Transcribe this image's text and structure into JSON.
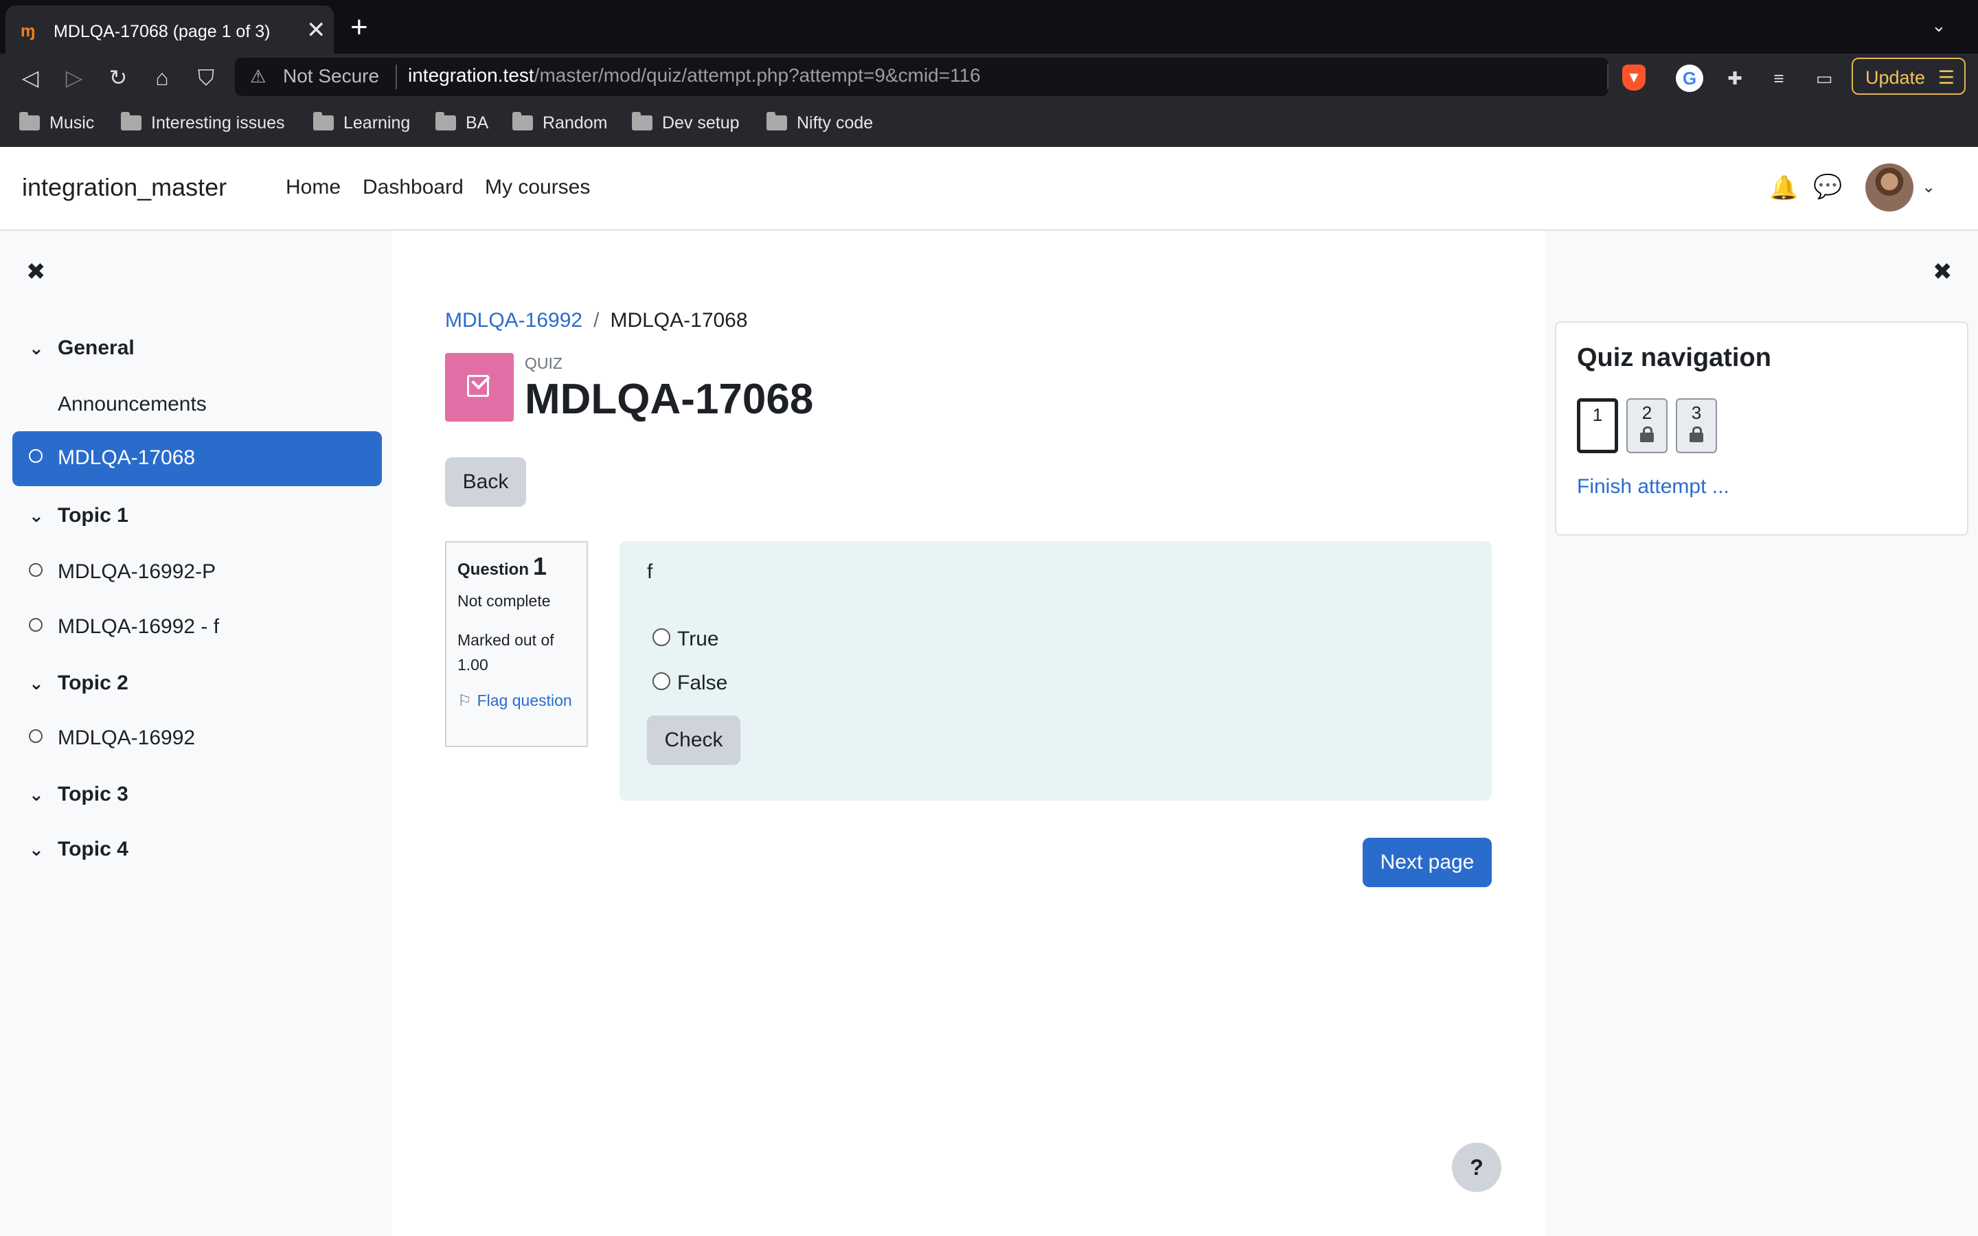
{
  "browser": {
    "tab_title": "MDLQA-17068 (page 1 of 3)",
    "tab_close": "✕",
    "new_tab": "+",
    "not_secure": "Not Secure",
    "url_host": "integration.test",
    "url_path": "/master/mod/quiz/attempt.php?attempt=9&cmid=116",
    "update_label": "Update",
    "bookmarks": [
      "Music",
      "Interesting issues",
      "Learning",
      "BA",
      "Random",
      "Dev setup",
      "Nifty code"
    ]
  },
  "header": {
    "site_name": "integration_master",
    "nav": [
      "Home",
      "Dashboard",
      "My courses"
    ]
  },
  "course_index": {
    "close": "✖",
    "sections": [
      {
        "name": "General",
        "items": [
          "Announcements",
          "MDLQA-17068"
        ]
      },
      {
        "name": "Topic 1",
        "items": [
          "MDLQA-16992-P",
          "MDLQA-16992 - f"
        ]
      },
      {
        "name": "Topic 2",
        "items": [
          "MDLQA-16992"
        ]
      },
      {
        "name": "Topic 3",
        "items": []
      },
      {
        "name": "Topic 4",
        "items": []
      }
    ],
    "active_item": "MDLQA-17068"
  },
  "main": {
    "breadcrumb": [
      "MDLQA-16992",
      "MDLQA-17068"
    ],
    "breadcrumb_sep": "/",
    "module_label": "QUIZ",
    "title": "MDLQA-17068",
    "back_label": "Back",
    "question": {
      "label": "Question",
      "number": "1",
      "state": "Not complete",
      "marked": "Marked out of 1.00",
      "flag": "Flag question",
      "text": "f",
      "options": [
        "True",
        "False"
      ],
      "check_label": "Check"
    },
    "next_label": "Next page",
    "help_label": "?"
  },
  "quiz_nav": {
    "close": "✖",
    "title": "Quiz navigation",
    "buttons": [
      "1",
      "2",
      "3"
    ],
    "finish_label": "Finish attempt ..."
  }
}
